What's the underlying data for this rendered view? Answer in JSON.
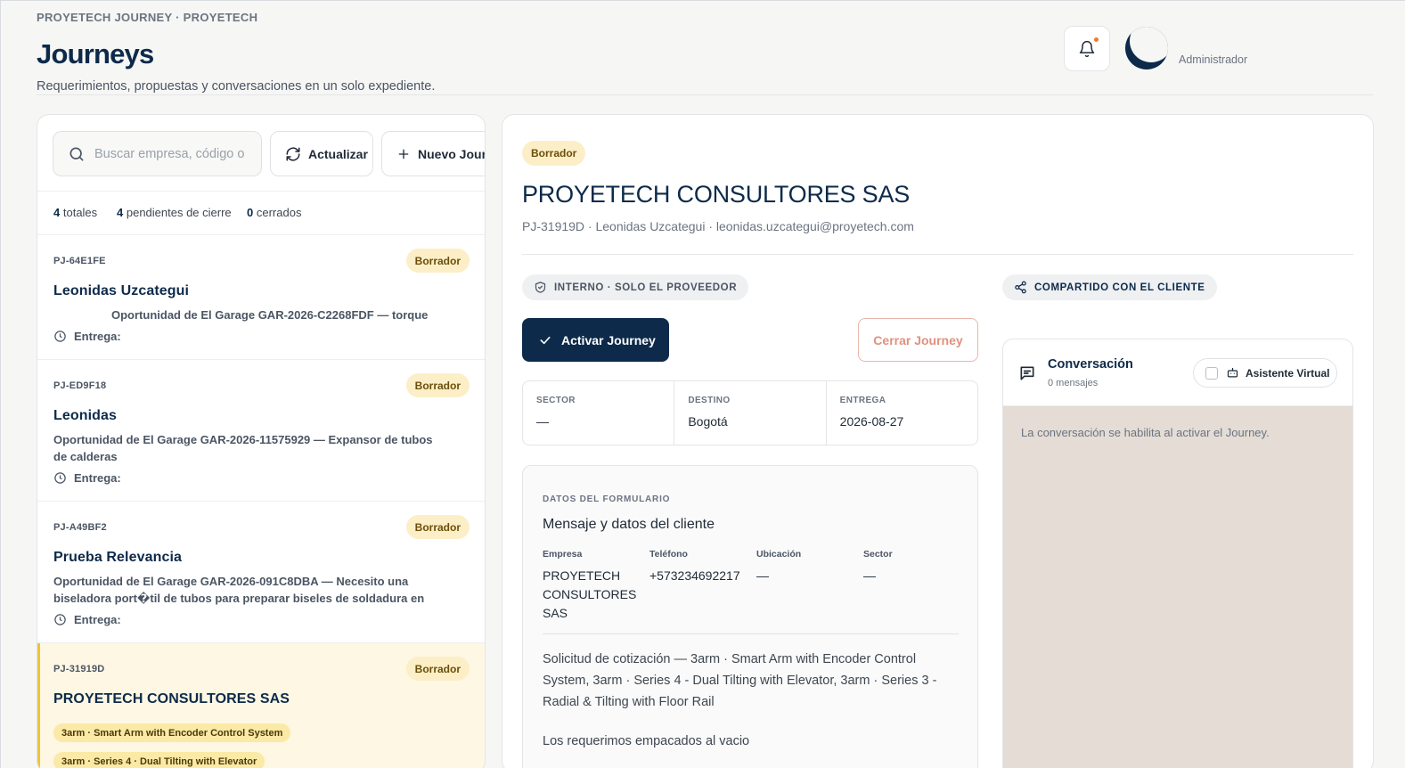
{
  "header": {
    "breadcrumb": "PROYETECH JOURNEY · PROYETECH",
    "title": "Journeys",
    "subtitle": "Requerimientos, propuestas y conversaciones en un solo expediente.",
    "user_role": "Administrador",
    "notification_icon": "bell-icon",
    "notification_dot_color": "#f07b2e"
  },
  "toolbar": {
    "search_placeholder": "Buscar empresa, código o",
    "refresh_label": "Actualizar",
    "new_label": "Nuevo Journ"
  },
  "stats": {
    "total_count": "4",
    "total_label": "totales",
    "pending_count": "4",
    "pending_label": "pendientes de cierre",
    "closed_count": "0",
    "closed_label": "cerrados"
  },
  "journeys": [
    {
      "code": "PJ-64E1FE",
      "status": "Borrador",
      "name": "Leonidas Uzcategui",
      "description": "Oportunidad de El Garage GAR-2026-C2268FDF — torque",
      "entrega_label": "Entrega:"
    },
    {
      "code": "PJ-ED9F18",
      "status": "Borrador",
      "name": "Leonidas",
      "description": "Oportunidad de El Garage GAR-2026-11575929 — Expansor de tubos de calderas",
      "entrega_label": "Entrega:"
    },
    {
      "code": "PJ-A49BF2",
      "status": "Borrador",
      "name": "Prueba Relevancia",
      "description": "Oportunidad de El Garage GAR-2026-091C8DBA — Necesito una biseladora port�til de tubos para preparar biseles de soldadura en campo, di�metros...",
      "entrega_label": "Entrega:"
    },
    {
      "code": "PJ-31919D",
      "status": "Borrador",
      "name": "PROYETECH CONSULTORES SAS",
      "tags": [
        "3arm · Smart Arm with Encoder Control System",
        "3arm · Series 4 · Dual Tilting with Elevator"
      ]
    }
  ],
  "detail": {
    "status": "Borrador",
    "company": "PROYETECH CONSULTORES SAS",
    "meta": "PJ-31919D · Leonidas Uzcategui · leonidas.uzcategui@proyetech.com",
    "internal_chip": "INTERNO · SOLO EL PROVEEDOR",
    "shared_chip": "COMPARTIDO CON EL CLIENTE",
    "activate_label": "Activar Journey",
    "close_label": "Cerrar Journey",
    "info": [
      {
        "label": "SECTOR",
        "value": "—"
      },
      {
        "label": "DESTINO",
        "value": "Bogotá"
      },
      {
        "label": "ENTREGA",
        "value": "2026-08-27"
      }
    ],
    "form": {
      "kicker": "DATOS DEL FORMULARIO",
      "title": "Mensaje y datos del cliente",
      "fields": [
        {
          "label": "Empresa",
          "value": "PROYETECH CONSULTORES SAS"
        },
        {
          "label": "Teléfono",
          "value": "+573234692217"
        },
        {
          "label": "Ubicación",
          "value": "—"
        },
        {
          "label": "Sector",
          "value": "—"
        }
      ],
      "body": "Solicitud de cotización — 3arm · Smart Arm with Encoder Control System, 3arm · Series 4 - Dual Tilting with Elevator, 3arm · Series 3 - Radial & Tilting with Floor Rail",
      "note": "Los requerimos empacados al vacio"
    }
  },
  "chat": {
    "title": "Conversación",
    "subtitle": "0 mensajes",
    "assistant_label": "Asistente Virtual",
    "empty_message": "La conversación se habilita al activar el Journey."
  },
  "colors": {
    "brand": "#0d2a4a",
    "badge_bg": "#fcefc7",
    "selected_accent": "#f0c533",
    "danger": "#e0917f",
    "chat_bg": "#e4dcd5"
  }
}
